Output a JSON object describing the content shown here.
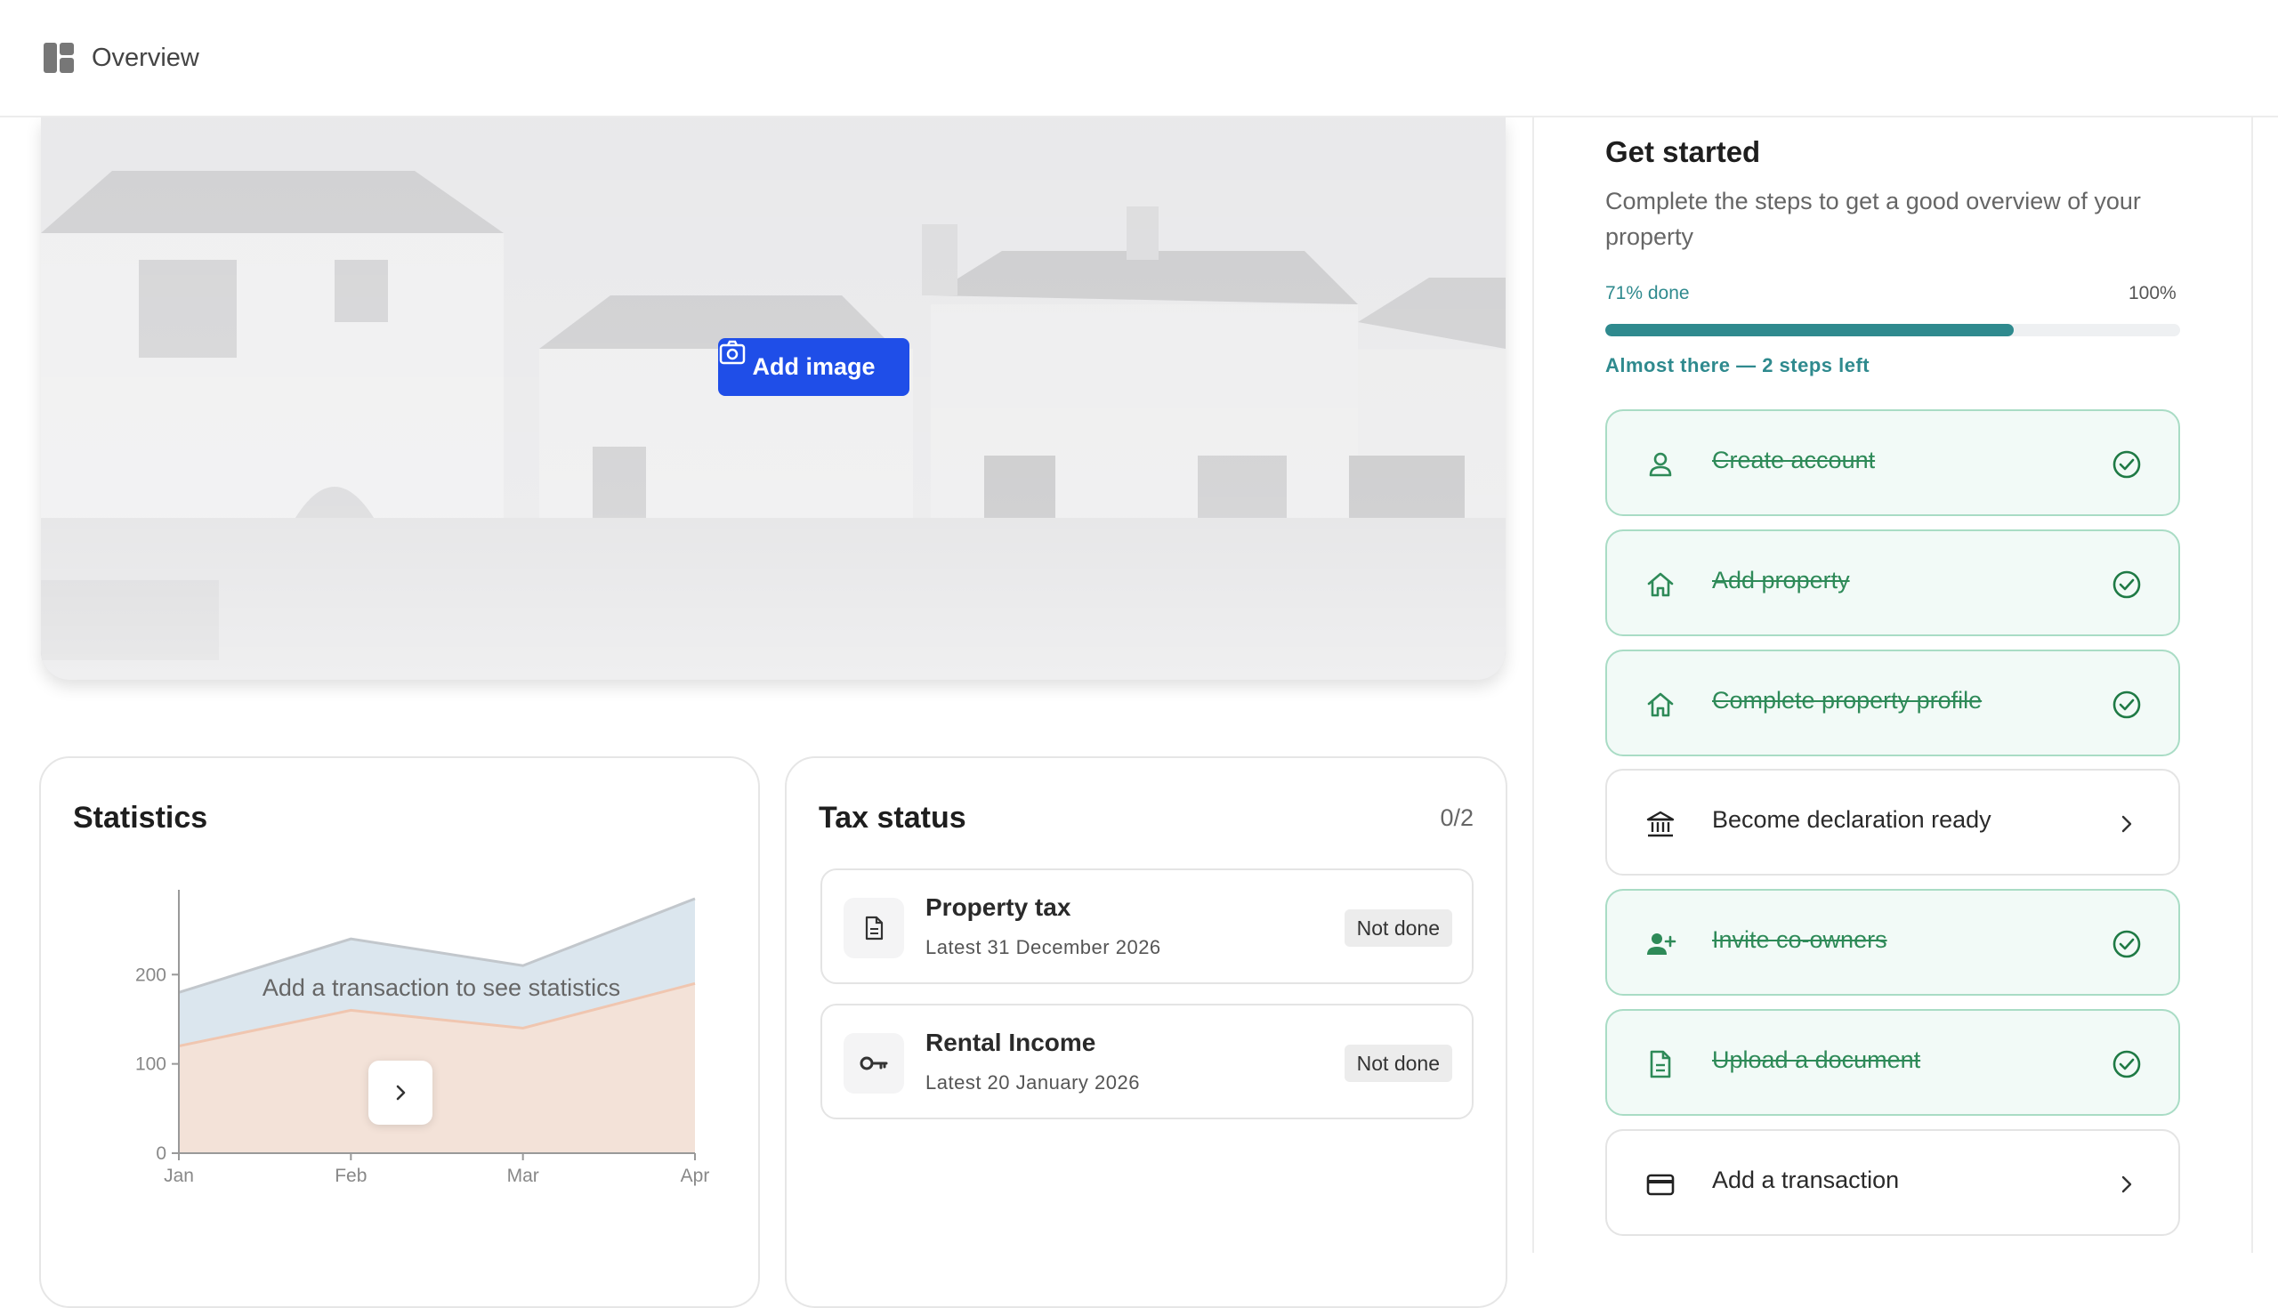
{
  "header": {
    "title": "Overview",
    "icon": "layout-dashboard-icon"
  },
  "hero": {
    "add_image_label": "Add image"
  },
  "statistics": {
    "title": "Statistics",
    "empty_message": "Add a transaction to see statistics",
    "chart_data": {
      "type": "area",
      "categories": [
        "Jan",
        "Feb",
        "Mar",
        "Apr"
      ],
      "yticks": [
        0,
        100,
        200
      ],
      "ylim": [
        0,
        285
      ],
      "series": [
        {
          "values": [
            180,
            240,
            210,
            285
          ],
          "color": "#dbe6ee"
        },
        {
          "values": [
            120,
            160,
            140,
            190
          ],
          "color": "#f3e2d8"
        }
      ]
    }
  },
  "tax": {
    "title": "Tax status",
    "count": "0/2",
    "items": [
      {
        "name": "Property tax",
        "date": "Latest 31 December 2026",
        "status": "Not done",
        "icon": "document-icon"
      },
      {
        "name": "Rental Income",
        "date": "Latest 20 January 2026",
        "status": "Not done",
        "icon": "key-icon"
      }
    ]
  },
  "get_started": {
    "title": "Get started",
    "subtitle": "Complete the steps to get a good overview of your property",
    "progress_label": "71% done",
    "progress_max_label": "100%",
    "progress_fraction": 0.71,
    "progress_note": "Almost there — 2 steps left",
    "steps": [
      {
        "label": "Create account",
        "done": true,
        "icon": "user-icon"
      },
      {
        "label": "Add property",
        "done": true,
        "icon": "home-icon"
      },
      {
        "label": "Complete property profile",
        "done": true,
        "icon": "home-icon"
      },
      {
        "label": "Become declaration ready",
        "done": false,
        "icon": "bank-icon"
      },
      {
        "label": "Invite co-owners",
        "done": true,
        "icon": "user-plus-icon"
      },
      {
        "label": "Upload a document",
        "done": true,
        "icon": "document-icon"
      },
      {
        "label": "Add a transaction",
        "done": false,
        "icon": "credit-card-icon"
      }
    ]
  },
  "colors": {
    "accent": "#1f4ee8",
    "progress": "#2f8a8e",
    "done_green": "#2e8a58"
  }
}
